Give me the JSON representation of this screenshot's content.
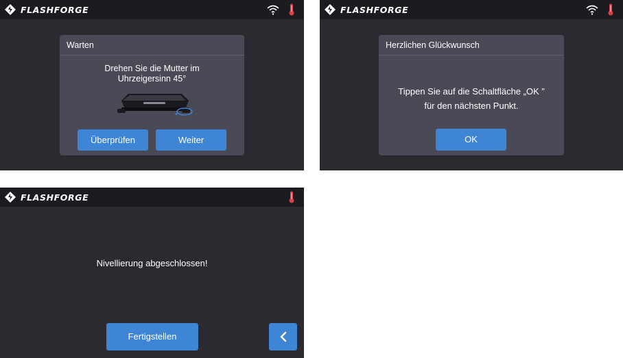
{
  "brand": {
    "logo_text": "FLASHFORGE"
  },
  "colors": {
    "screen_bg": "#2b2a31",
    "topbar_bg": "#1c1c20",
    "dialog_bg": "#4a4a56",
    "button_blue": "#3f85d6",
    "thermometer_red": "#d9414a",
    "text": "#ffffff"
  },
  "screen1": {
    "icons": [
      "flashforge-logo-icon",
      "wifi-icon",
      "thermometer-icon",
      "build-plate-illustration"
    ],
    "dialog": {
      "title": "Warten",
      "message_line1": "Drehen Sie die Mutter im",
      "message_line2": "Uhrzeigersinn 45°",
      "check_button": "Überprüfen",
      "next_button": "Weiter"
    }
  },
  "screen2": {
    "icons": [
      "flashforge-logo-icon",
      "wifi-icon",
      "thermometer-icon"
    ],
    "dialog": {
      "title": "Herzlichen Glückwunsch",
      "message_line1": "Tippen Sie auf die Schaltfläche „OK ”",
      "message_line2": "für den nächsten Punkt.",
      "ok_button": "OK"
    }
  },
  "screen3": {
    "icons": [
      "flashforge-logo-icon",
      "thermometer-icon",
      "chevron-left-icon"
    ],
    "message": "Nivellierung abgeschlossen!",
    "finish_button": "Fertigstellen"
  }
}
